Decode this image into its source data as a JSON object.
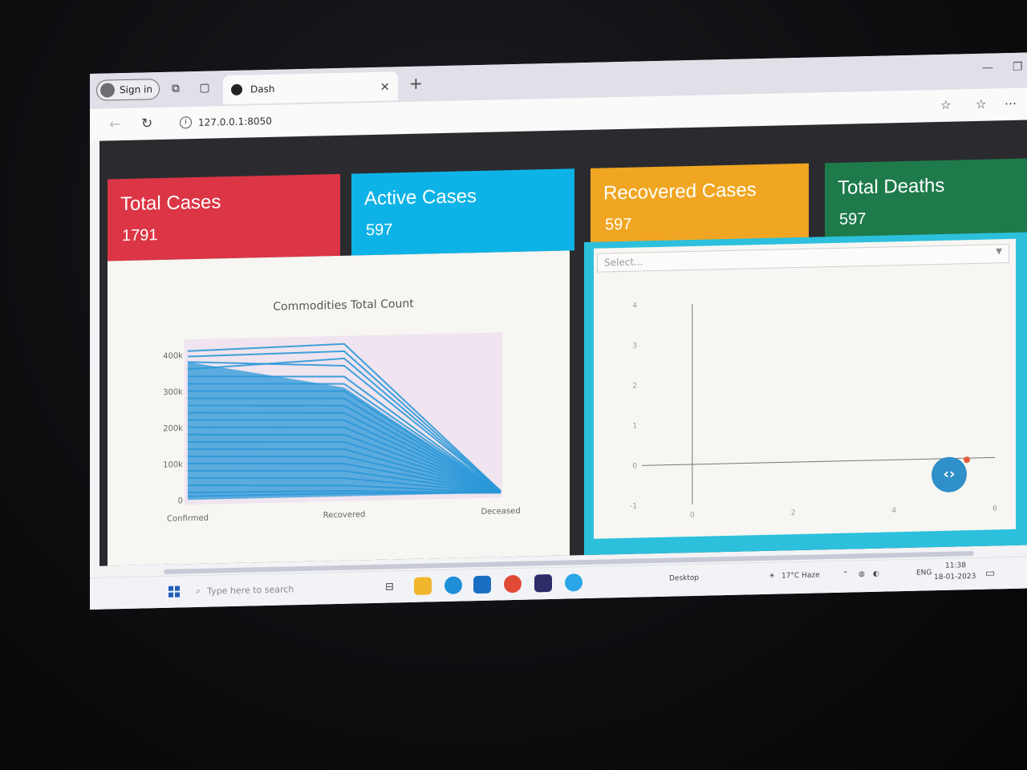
{
  "browser": {
    "signin_label": "Sign in",
    "tab_title": "Dash",
    "url": "127.0.0.1:8050",
    "new_tab_glyph": "+",
    "close_tab_glyph": "×"
  },
  "cards": [
    {
      "title": "Total Cases",
      "value": "1791",
      "color": "#dc3545"
    },
    {
      "title": "Active Cases",
      "value": "597",
      "color": "#0db3e6"
    },
    {
      "title": "Recovered Cases",
      "value": "597",
      "color": "#f0a622"
    },
    {
      "title": "Total Deaths",
      "value": "597",
      "color": "#1e7a4a"
    }
  ],
  "left_chart": {
    "title": "Commodities Total Count",
    "categories": [
      "Confirmed",
      "Recovered",
      "Deceased"
    ],
    "y_ticks": [
      "400k",
      "300k",
      "200k",
      "100k",
      "0"
    ],
    "color": "#2b98d8"
  },
  "right_panel": {
    "select_placeholder": "Select...",
    "y_ticks": [
      "4",
      "3",
      "2",
      "1",
      "0",
      "-1"
    ],
    "x_ticks": [
      "0",
      "2",
      "4",
      "6"
    ]
  },
  "chart_data": [
    {
      "type": "line",
      "title": "Commodities Total Count",
      "categories": [
        "Confirmed",
        "Recovered",
        "Deceased"
      ],
      "ylim": [
        0,
        420000
      ],
      "series_shape_note": "many overlapping series",
      "series": [
        {
          "values": [
            410000,
            420000,
            5000
          ]
        },
        {
          "values": [
            395000,
            400000,
            4000
          ]
        },
        {
          "values": [
            380000,
            360000,
            3500
          ]
        },
        {
          "values": [
            360000,
            380000,
            3000
          ]
        },
        {
          "values": [
            340000,
            330000,
            2800
          ]
        },
        {
          "values": [
            320000,
            310000,
            2500
          ]
        },
        {
          "values": [
            300000,
            290000,
            2200
          ]
        },
        {
          "values": [
            280000,
            270000,
            2000
          ]
        },
        {
          "values": [
            260000,
            250000,
            1800
          ]
        },
        {
          "values": [
            240000,
            230000,
            1600
          ]
        },
        {
          "values": [
            220000,
            210000,
            1400
          ]
        },
        {
          "values": [
            200000,
            190000,
            1200
          ]
        },
        {
          "values": [
            180000,
            170000,
            1000
          ]
        },
        {
          "values": [
            160000,
            150000,
            900
          ]
        },
        {
          "values": [
            140000,
            130000,
            800
          ]
        },
        {
          "values": [
            120000,
            110000,
            700
          ]
        },
        {
          "values": [
            100000,
            90000,
            600
          ]
        },
        {
          "values": [
            80000,
            70000,
            500
          ]
        },
        {
          "values": [
            60000,
            50000,
            400
          ]
        },
        {
          "values": [
            40000,
            30000,
            300
          ]
        },
        {
          "values": [
            20000,
            15000,
            200
          ]
        },
        {
          "values": [
            10000,
            8000,
            100
          ]
        }
      ]
    },
    {
      "type": "scatter",
      "xlim": [
        -1,
        6
      ],
      "ylim": [
        -1,
        4
      ],
      "series": []
    }
  ],
  "taskbar": {
    "search_placeholder": "Type here to search",
    "desktop_label": "Desktop",
    "weather": "17°C  Haze",
    "lang": "ENG",
    "time": "11:38",
    "date": "18-01-2023"
  }
}
